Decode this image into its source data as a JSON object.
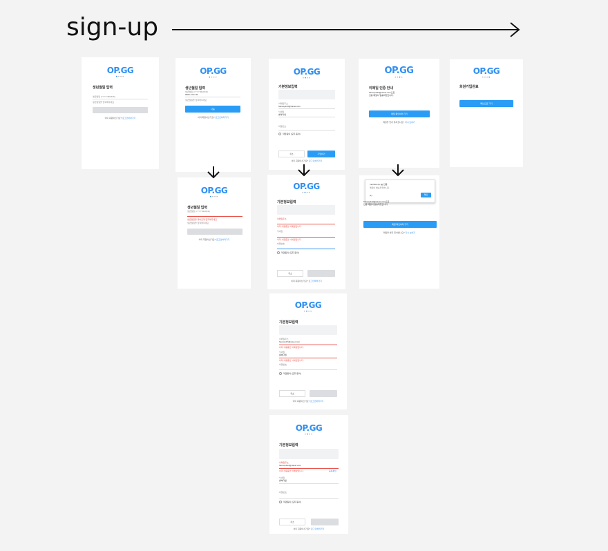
{
  "title": "sign-up",
  "logo": "OP.GG",
  "birth": {
    "heading": "생년월일 입력",
    "prompt": "생년월일을 입력해주세요",
    "label": "생년월일 (YYYY/MM/DD)",
    "value": "0000 / 00 / 00",
    "error": "생년월일을 올바르게 입력해주세요.",
    "next": "다음"
  },
  "info": {
    "heading": "기본정보입력",
    "email_label": "이메일주소",
    "email_value": "hancop123@naver.com",
    "email_value_2": "hancop17@naver.com",
    "nick_label": "닉네임",
    "nick_value": "롤하다잉",
    "pw_label": "비밀번호",
    "agree": "약관동의 (모두 동의)",
    "email_error": "이미 사용중인 이메일입니다.",
    "nick_error": "이미 사용중인 닉네임입니다.",
    "email_link": "중복확인",
    "cancel": "취소",
    "confirm": "가입하기"
  },
  "verify": {
    "heading": "이메일 인증 안내",
    "address": "hancop123@naver.com으로",
    "sent": "인증 메일이 발송되었습니다.",
    "cta": "메일 확인하러 가기",
    "resend": "메일을 받지 못하셨나요?",
    "resend_link": "다시 보내기",
    "popup_from": "member.op.gg 인증",
    "popup_msg": "메일이 발송되었습니다.",
    "popup_code": "(1)",
    "popup_btn": "확인"
  },
  "done": {
    "heading": "회원가입완료",
    "cta": "메인으로 가기"
  },
  "footer": {
    "question": "이미 회원이신가요?",
    "link": "로그인하러가기"
  }
}
